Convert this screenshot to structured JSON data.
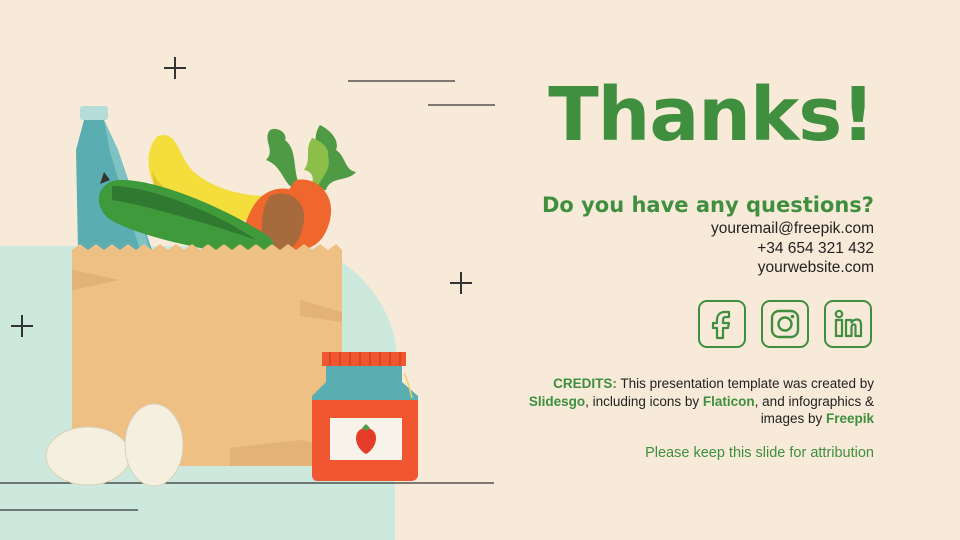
{
  "slide": {
    "title": "Thanks!",
    "subtitle": "Do you have any questions?",
    "contact": {
      "email": "youremail@freepik.com",
      "phone": "+34 654 321 432",
      "website": "yourwebsite.com"
    },
    "social_icons": [
      "facebook-icon",
      "instagram-icon",
      "linkedin-icon"
    ],
    "credits": {
      "label": "CREDITS:",
      "text_1": " This presentation template was created by ",
      "slidesgo": "Slidesgo",
      "text_2": ", including icons by ",
      "flaticon": "Flaticon",
      "text_3": ", and infographics & images by ",
      "freepik": "Freepik"
    },
    "attribution_note": "Please keep this slide for attribution"
  },
  "colors": {
    "background": "#f7ead8",
    "accent_green": "#3f8f3f",
    "mint": "#cde8dc",
    "bag": "#efc084",
    "jar_red": "#f0562f",
    "jar_teal": "#5aadb1"
  }
}
